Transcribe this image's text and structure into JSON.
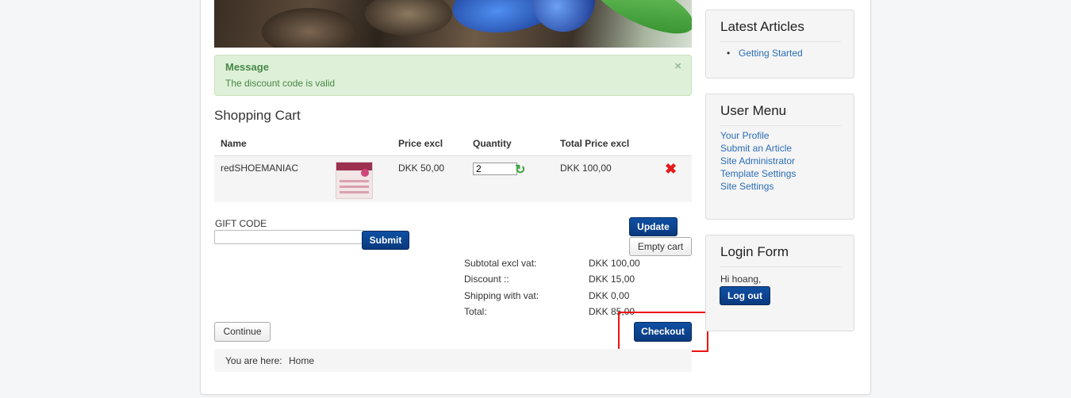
{
  "alert": {
    "title": "Message",
    "text": "The discount code is valid",
    "close_symbol": "×"
  },
  "cart": {
    "title": "Shopping Cart",
    "columns": [
      "Name",
      "Price excl",
      "Quantity",
      "Total Price excl"
    ],
    "items": [
      {
        "name": "redSHOEMANIAC",
        "price": "DKK 50,00",
        "quantity": "2",
        "total": "DKK 100,00"
      }
    ],
    "refresh_icon": "refresh-icon",
    "delete_icon": "delete-icon",
    "delete_symbol": "✖",
    "refresh_symbol": "↻"
  },
  "gift": {
    "label": "GIFT CODE",
    "value": "",
    "submit_label": "Submit"
  },
  "buttons": {
    "update": "Update",
    "empty_cart": "Empty cart",
    "continue": "Continue",
    "checkout": "Checkout"
  },
  "totals": [
    {
      "label": "Subtotal excl vat:",
      "value": "DKK 100,00"
    },
    {
      "label": "Discount ::",
      "value": "DKK 15,00"
    },
    {
      "label": "Shipping with vat:",
      "value": "DKK 0,00"
    },
    {
      "label": "Total:",
      "value": "DKK 85,00"
    }
  ],
  "breadcrumb": {
    "label": "You are here:",
    "home": "Home"
  },
  "sidebar": {
    "latest_articles": {
      "title": "Latest Articles",
      "items": [
        "Getting Started"
      ]
    },
    "user_menu": {
      "title": "User Menu",
      "items": [
        "Your Profile",
        "Submit an Article",
        "Site Administrator",
        "Template Settings",
        "Site Settings"
      ]
    },
    "login_form": {
      "title": "Login Form",
      "greeting": "Hi hoang,",
      "logout_label": "Log out"
    }
  },
  "colors": {
    "primary_button": "#0a3a7e",
    "link": "#2a6db5",
    "alert_bg": "#dff0d8",
    "alert_text": "#468847",
    "highlight_border": "#ee1111"
  }
}
